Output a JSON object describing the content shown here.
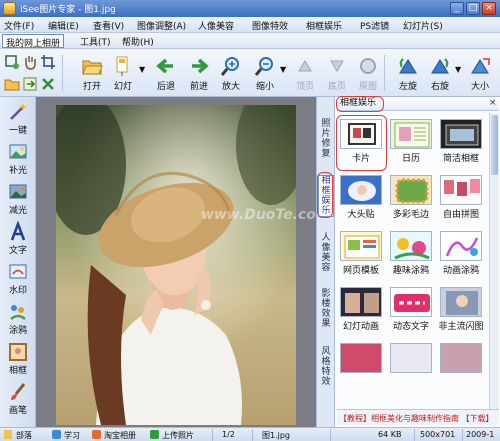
{
  "window": {
    "title": "iSee图片专家 - 图1.jpg",
    "minimize": "_",
    "maximize": "□",
    "close": "×"
  },
  "menu": [
    "文件(F)",
    "编辑(E)",
    "查看(V)",
    "图像调整(A)",
    "人像美容",
    "图像特效",
    "相框娱乐",
    "PS滤镜",
    "幻灯片(S)"
  ],
  "submenu": [
    "我的网上相册",
    "工具(T)",
    "帮助(H)"
  ],
  "toolbar": {
    "open": "打开",
    "slideshow": "幻灯",
    "back": "后退",
    "forward": "前进",
    "zoom_in": "放大",
    "zoom_out": "缩小",
    "first": "顶页",
    "last": "底页",
    "restore": "原图",
    "rotate_left": "左旋",
    "rotate_right": "右旋",
    "size": "大小"
  },
  "left_tools": [
    "一键",
    "补光",
    "减光",
    "文字",
    "水印",
    "涂鸦",
    "相框",
    "画笔"
  ],
  "vertical_tabs": [
    "照片修复",
    "相框娱乐",
    "人像美容",
    "影楼效果",
    "风格特效"
  ],
  "panel": {
    "title": "相框娱乐",
    "close": "×",
    "items": [
      "卡片",
      "日历",
      "简洁相框",
      "大头贴",
      "多彩毛边",
      "自由拼图",
      "网页模板",
      "趣味涂鸦",
      "动画涂鸦",
      "幻灯动画",
      "动态文字",
      "非主流闪图"
    ],
    "footer": "【教程】相框美化与趣味制作指南 【下载】"
  },
  "watermark": "www.DuoTe.com",
  "status": {
    "folder": "部落",
    "learn": "学习",
    "taobao": "淘宝相册",
    "upload": "上传照片",
    "page": "1/2",
    "filename": "图1.jpg",
    "filesize": "64 KB",
    "dimensions": "500x701",
    "date": "2009-1"
  },
  "colors": {
    "accent": "#3d6fc2",
    "highlight": "#e33a3a"
  }
}
